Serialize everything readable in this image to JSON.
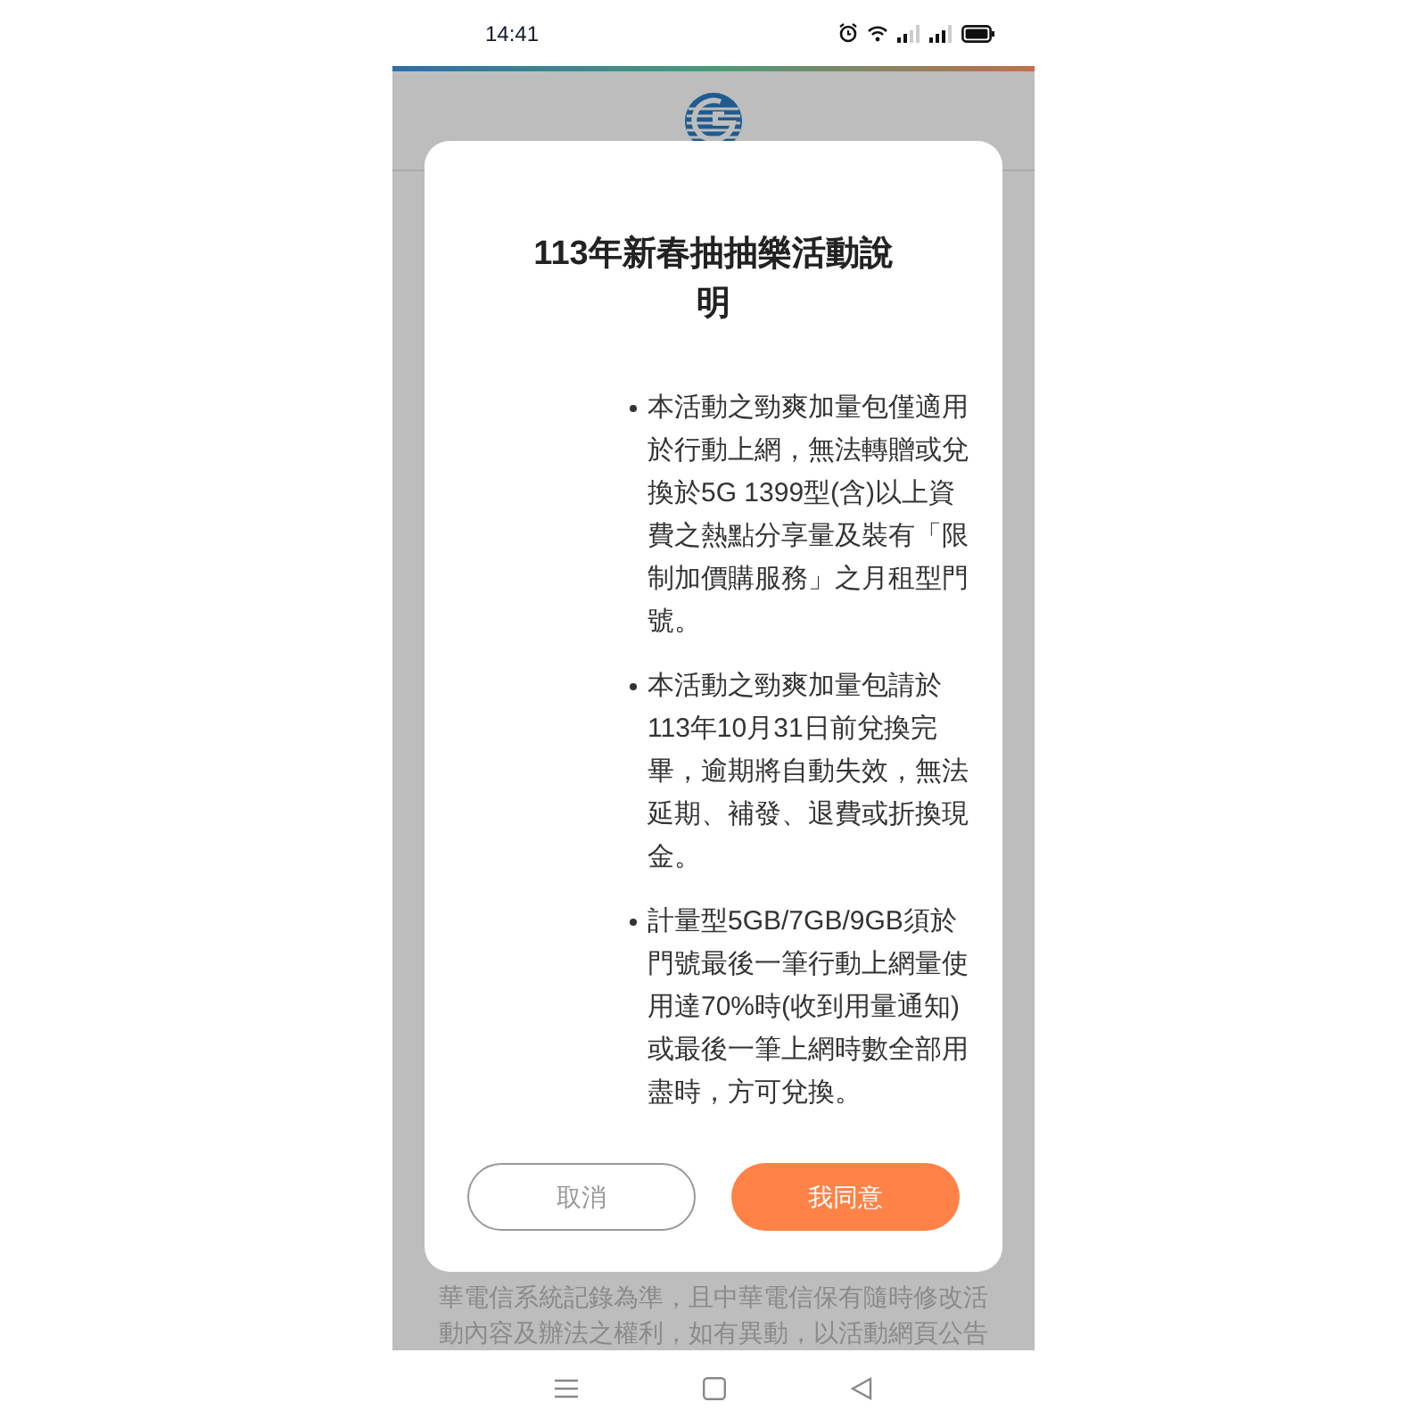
{
  "status_bar": {
    "time": "14:41"
  },
  "background_text": [
    "華電信系統記錄為準，且中華電信保有隨時修改活",
    "動內容及辦法之權利，如有異動，以活動網頁公告"
  ],
  "dialog": {
    "title": "113年新春抽抽樂活動說明",
    "items": [
      "本活動之勁爽加量包僅適用於行動上網，無法轉贈或兌換於5G 1399型(含)以上資費之熱點分享量及裝有「限制加價購服務」之月租型門號。",
      "本活動之勁爽加量包請於113年10月31日前兌換完畢，逾期將自動失效，無法延期、補發、退費或折換現金。",
      "計量型5GB/7GB/9GB須於門號最後一筆行動上網量使用達70%時(收到用量通知)或最後一筆上網時數全部用盡時，方可兌換。"
    ],
    "buttons": [
      {
        "label": "取消",
        "kind": "secondary"
      },
      {
        "label": "我同意",
        "kind": "primary"
      }
    ]
  }
}
